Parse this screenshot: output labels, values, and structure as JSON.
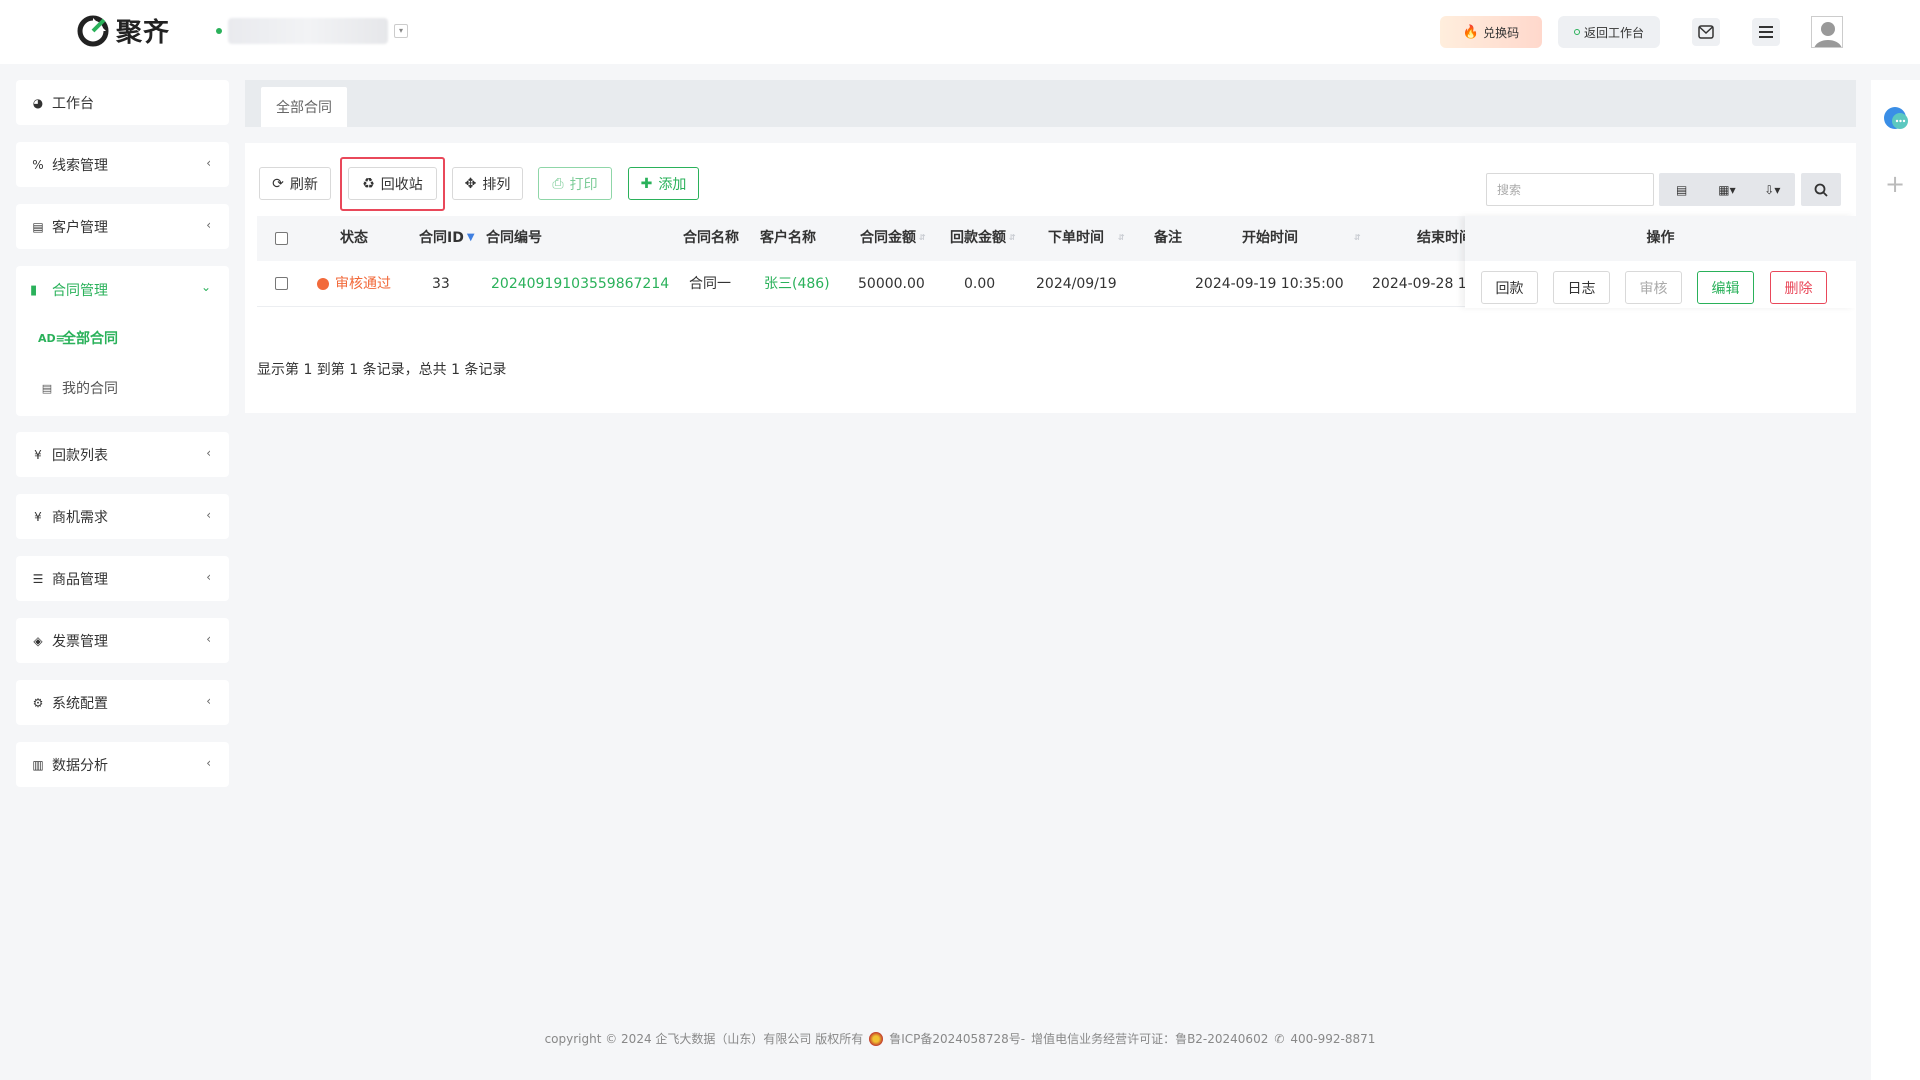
{
  "brand": {
    "name": "聚齐",
    "accent": "#2ab15a"
  },
  "header": {
    "org_name": "",
    "redeem_label": "兑换码",
    "back_label": "返回工作台"
  },
  "sidebar": {
    "items": [
      {
        "label": "工作台",
        "icon": "dashboard-icon"
      },
      {
        "label": "线索管理",
        "icon": "link-icon"
      },
      {
        "label": "客户管理",
        "icon": "id-card-icon"
      },
      {
        "label": "合同管理",
        "icon": "bookmark-icon",
        "expanded": true,
        "children": [
          {
            "label": "全部合同",
            "active": true
          },
          {
            "label": "我的合同"
          }
        ]
      },
      {
        "label": "回款列表",
        "icon": "yen-icon"
      },
      {
        "label": "商机需求",
        "icon": "yen-icon"
      },
      {
        "label": "商品管理",
        "icon": "list-icon"
      },
      {
        "label": "发票管理",
        "icon": "tag-icon"
      },
      {
        "label": "系统配置",
        "icon": "gears-icon"
      },
      {
        "label": "数据分析",
        "icon": "bar-chart-icon"
      }
    ]
  },
  "tabs": [
    {
      "label": "全部合同"
    }
  ],
  "toolbar": {
    "refresh": "刷新",
    "recycle": "回收站",
    "arrange": "排列",
    "print": "打印",
    "add": "添加",
    "search_placeholder": "搜索"
  },
  "table": {
    "columns": [
      "状态",
      "合同ID",
      "合同编号",
      "合同名称",
      "客户名称",
      "合同金额",
      "回款金额",
      "下单时间",
      "备注",
      "开始时间",
      "结束时间",
      "操作"
    ],
    "rows": [
      {
        "status": "审核通过",
        "id": "33",
        "number": "20240919103559867214",
        "name": "合同一",
        "customer": "张三(486)",
        "amount": "50000.00",
        "paid": "0.00",
        "order_date": "2024/09/19",
        "remark": "",
        "start": "2024-09-19 10:35:00",
        "end": "2024-09-28 1"
      }
    ],
    "actions": [
      "回款",
      "日志",
      "审核",
      "编辑",
      "删除"
    ]
  },
  "pager": {
    "text": "显示第 1 到第 1 条记录，总共 1 条记录"
  },
  "footer": {
    "copyright": "copyright © 2024 企飞大数据（山东）有限公司 版权所有",
    "icp": "鲁ICP备2024058728号-",
    "license": "增值电信业务经营许可证：鲁B2-20240602",
    "phone": "400-992-8871"
  }
}
